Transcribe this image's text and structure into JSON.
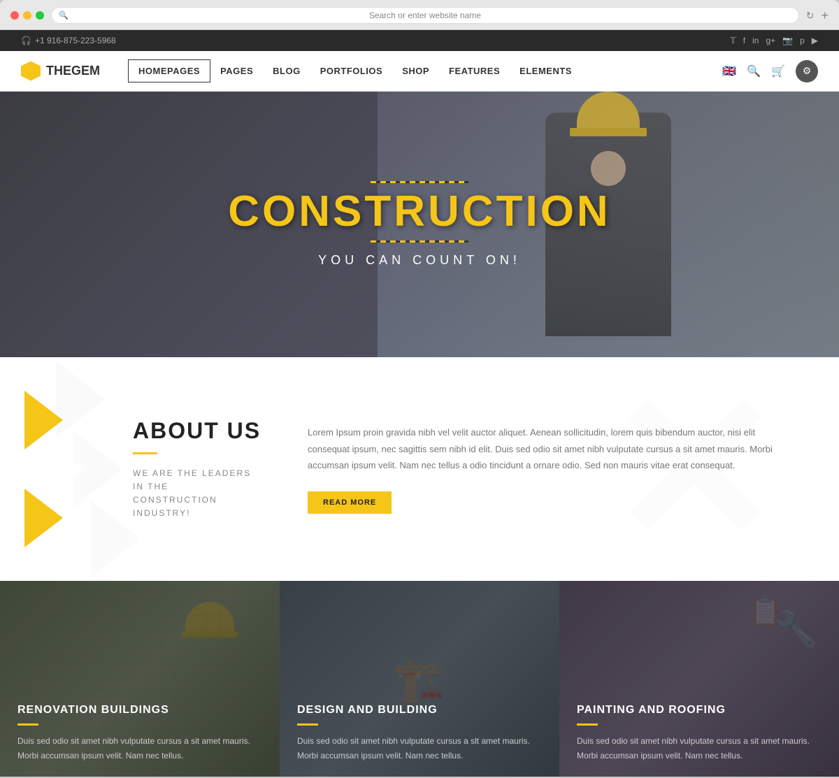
{
  "browser": {
    "address_placeholder": "Search or enter website name",
    "add_tab_label": "+"
  },
  "topbar": {
    "phone": "+1 916-875-223-5968",
    "social": [
      "𝕋",
      "f",
      "in",
      "g+",
      "📷",
      "p",
      "▶"
    ]
  },
  "navbar": {
    "logo_text": "THEGEM",
    "links": [
      {
        "label": "HOMEPAGES",
        "active": true
      },
      {
        "label": "PAGES",
        "active": false
      },
      {
        "label": "BLOG",
        "active": false
      },
      {
        "label": "PORTFOLIOS",
        "active": false
      },
      {
        "label": "SHOP",
        "active": false
      },
      {
        "label": "FEATURES",
        "active": false
      },
      {
        "label": "ELEMENTS",
        "active": false
      }
    ]
  },
  "hero": {
    "title": "CONSTRUCTION",
    "subtitle": "YOU CAN COUNT ON!"
  },
  "about": {
    "title": "ABOUT US",
    "divider": "",
    "subtitle": "WE ARE THE LEADERS IN THE\nCONSTRUCTION INDUSTRY!",
    "body": "Lorem Ipsum proin gravida nibh vel velit auctor aliquet. Aenean sollicitudin, lorem quis bibendum auctor, nisi elit consequat ipsum, nec sagittis sem nibh id elit. Duis sed odio sit amet nibh vulputate cursus a sit amet mauris. Morbi accumsan ipsum velit. Nam nec tellus a odio tincidunt a ornare odio. Sed non mauris vitae erat consequat.",
    "button_label": "READ MORE"
  },
  "services": [
    {
      "title": "RENOVATION BUILDINGS",
      "text": "Duis sed odio sit amet nibh vulputate cursus a sit amet mauris. Morbi accumsan ipsum velit. Nam nec tellus."
    },
    {
      "title": "DESIGN AND BUILDING",
      "text": "Duis sed odio sit amet nibh vulputate cursus a slt amet mauris. Morbi accumsan ipsum velit. Nam nec tellus."
    },
    {
      "title": "PAINTING AND ROOFING",
      "text": "Duis sed odio sit amet nibh vulputate cursus a sit amet mauris. Morbi accumsan ipsum velit. Nam nec tellus."
    }
  ]
}
